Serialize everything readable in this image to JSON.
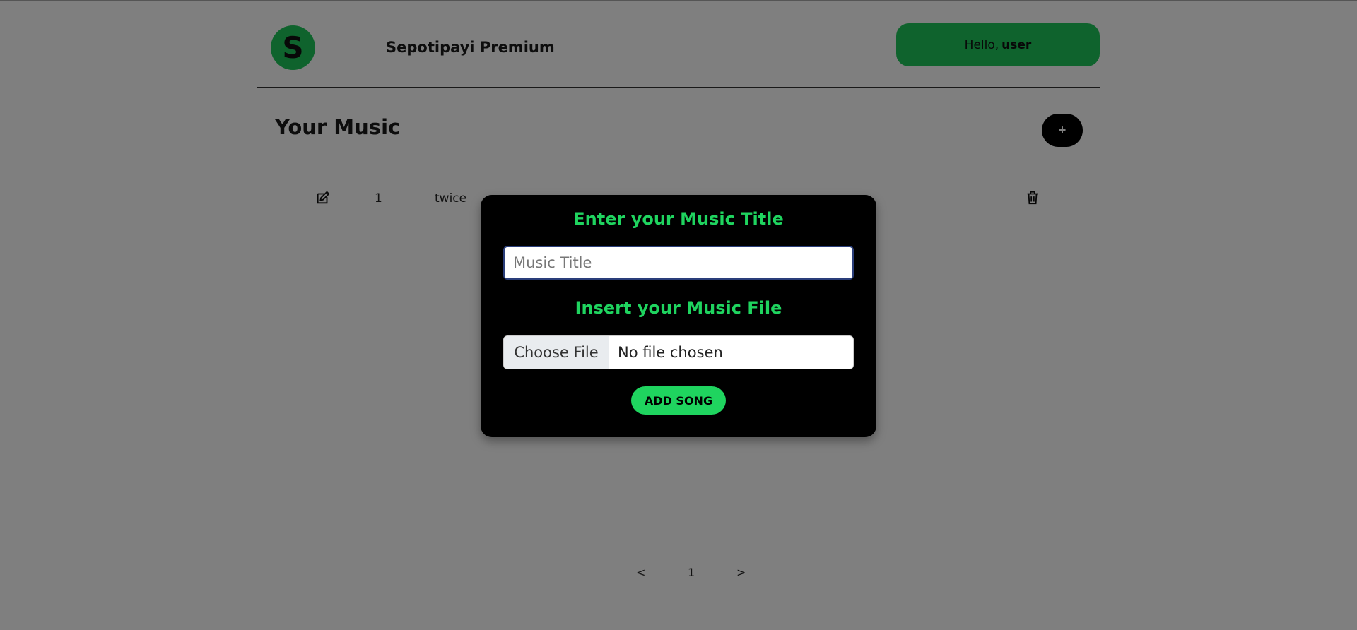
{
  "header": {
    "logo_letter": "S",
    "brand": "Sepotipayi Premium",
    "greeting": "Hello,",
    "username": "user"
  },
  "main": {
    "title": "Your Music",
    "add_label": "+",
    "rows": [
      {
        "index": "1",
        "title": "twice"
      }
    ]
  },
  "pagination": {
    "prev": "<",
    "page": "1",
    "next": ">"
  },
  "modal": {
    "title_heading": "Enter your Music Title",
    "title_placeholder": "Music Title",
    "file_heading": "Insert your Music File",
    "choose_file": "Choose File",
    "no_file": "No file chosen",
    "submit": "ADD SONG"
  },
  "colors": {
    "accent": "#1fd45f",
    "overlay": "rgba(0,0,0,0.5)"
  }
}
